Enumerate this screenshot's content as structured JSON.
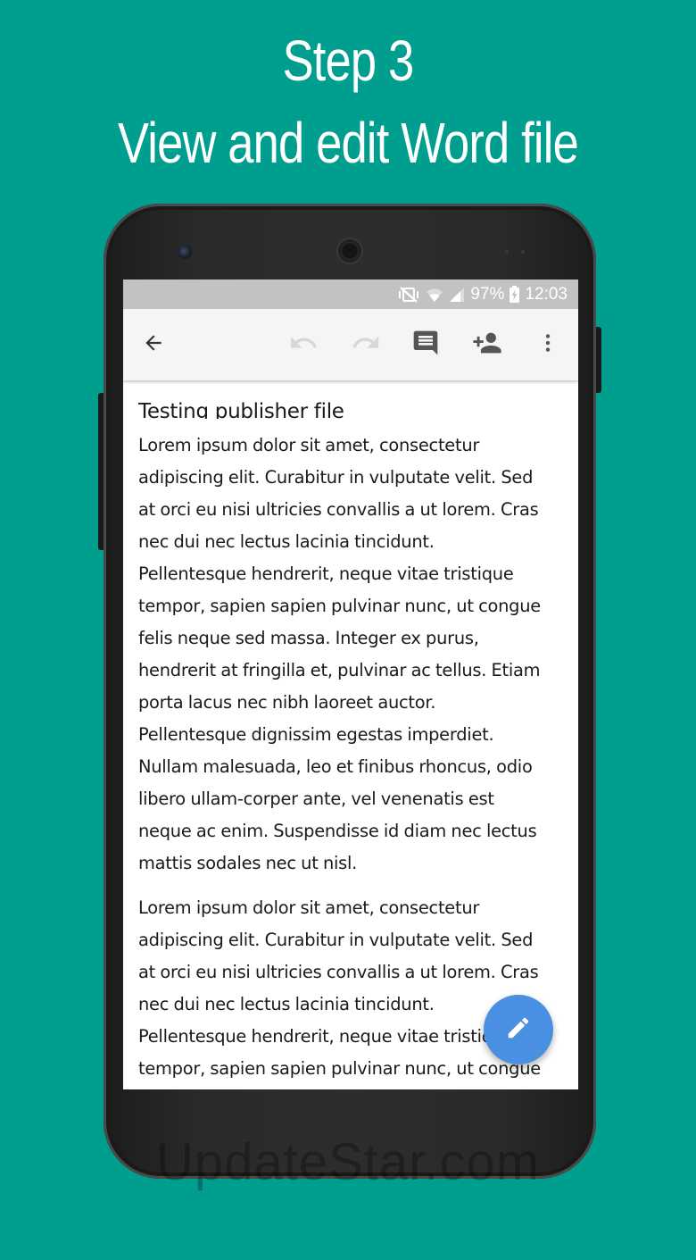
{
  "headline": {
    "line1": "Step 3",
    "line2": "View and edit Word file"
  },
  "status_bar": {
    "battery": "97%",
    "time": "12:03",
    "icons": [
      "mute-vibrate-icon",
      "wifi-icon",
      "signal-icon",
      "battery-charging-icon"
    ]
  },
  "toolbar": {
    "icons": [
      "back-arrow-icon",
      "undo-icon",
      "redo-icon",
      "comment-icon",
      "add-person-icon",
      "more-vert-icon"
    ],
    "undo_enabled": false,
    "redo_enabled": false
  },
  "document": {
    "title": "Testing publisher file",
    "paragraph1_lines": [
      "Lorem ipsum dolor sit amet, consectetur",
      "adipiscing elit. Curabitur in vulputate velit. Sed",
      "at orci eu nisi ultricies convallis a ut lorem. Cras",
      "nec dui nec lectus lacinia tincidunt.",
      "Pellentesque hendrerit, neque vitae tristique",
      "tempor, sapien sapien pulvinar nunc, ut congue",
      "felis neque sed massa. Integer ex purus,",
      "hendrerit at fringilla et, pulvinar ac tellus. Etiam",
      "porta lacus nec nibh laoreet auctor.",
      "Pellentesque dignissim egestas imperdiet.",
      "Nullam malesuada, leo et finibus rhoncus, odio",
      "libero ullam-corper ante, vel venenatis est",
      "neque ac enim. Suspendisse id diam nec lectus",
      "mattis sodales nec ut nisl."
    ],
    "paragraph2_lines": [
      "Lorem ipsum dolor sit amet, consectetur",
      "adipiscing elit. Curabitur in vulputate velit. Sed",
      "at orci eu nisi ultricies convallis a ut lorem. Cras",
      "nec dui nec lectus lacinia tincidunt.",
      "Pellentesque hendrerit, neque vitae tristique",
      "tempor, sapien sapien pulvinar nunc, ut congue"
    ]
  },
  "fab": {
    "icon": "pencil-icon",
    "color": "#4a90e2"
  },
  "watermark": "UpdateStar.com",
  "colors": {
    "background": "#009e8e",
    "status_bar": "#c2c2c2",
    "toolbar": "#f5f5f5",
    "fab": "#4a90e2"
  }
}
